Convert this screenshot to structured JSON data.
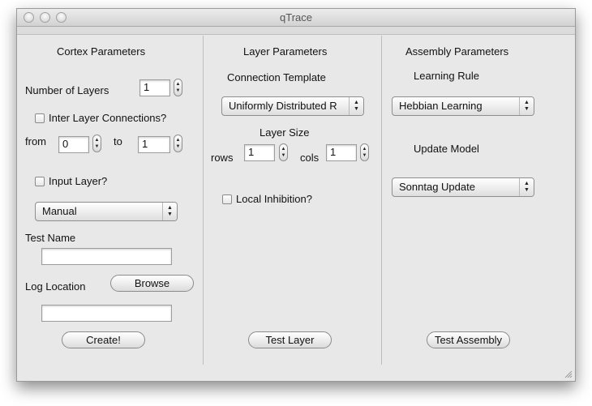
{
  "window": {
    "title": "qTrace"
  },
  "cortex": {
    "heading": "Cortex Parameters",
    "num_layers_label": "Number of Layers",
    "num_layers_value": "1",
    "inter_layer_label": "Inter Layer Connections?",
    "from_label": "from",
    "from_value": "0",
    "to_label": "to",
    "to_value": "1",
    "input_layer_label": "Input Layer?",
    "input_mode_selected": "Manual",
    "test_name_label": "Test Name",
    "test_name_value": "",
    "log_location_label": "Log Location",
    "browse_label": "Browse",
    "log_location_value": "",
    "create_label": "Create!"
  },
  "layer": {
    "heading": "Layer Parameters",
    "connection_template_label": "Connection Template",
    "connection_template_selected": "Uniformly Distributed R",
    "layer_size_label": "Layer Size",
    "rows_label": "rows",
    "rows_value": "1",
    "cols_label": "cols",
    "cols_value": "1",
    "local_inhibition_label": "Local Inhibition?",
    "test_layer_label": "Test Layer"
  },
  "assembly": {
    "heading": "Assembly Parameters",
    "learning_rule_label": "Learning Rule",
    "learning_rule_selected": "Hebbian Learning",
    "update_model_label": "Update Model",
    "update_model_selected": "Sonntag Update",
    "test_assembly_label": "Test Assembly"
  },
  "icons": {
    "stepper_up": "▲",
    "stepper_down": "▼"
  }
}
